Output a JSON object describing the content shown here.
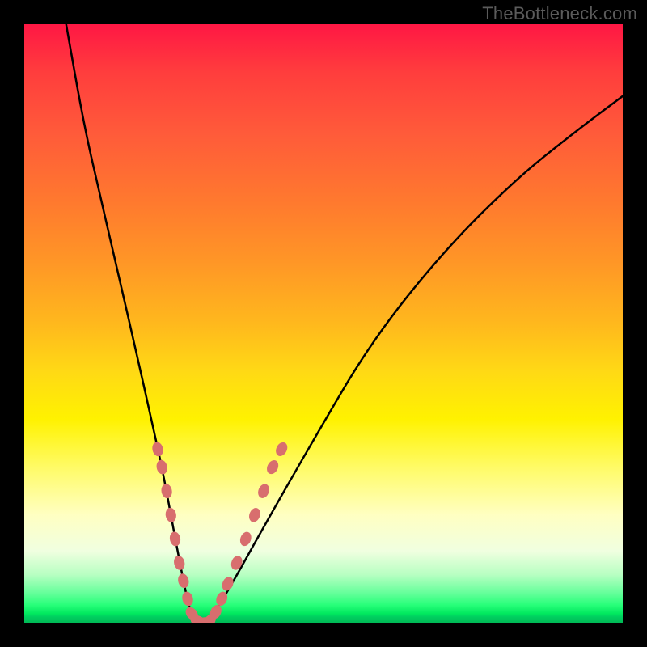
{
  "watermark": "TheBottleneck.com",
  "chart_data": {
    "type": "line",
    "title": "",
    "xlabel": "",
    "ylabel": "",
    "xlim": [
      0,
      100
    ],
    "ylim": [
      0,
      100
    ],
    "grid": false,
    "legend": false,
    "background_gradient_stops": [
      {
        "pct": 0,
        "color": "#ff1744"
      },
      {
        "pct": 8,
        "color": "#ff3d3d"
      },
      {
        "pct": 18,
        "color": "#ff5a3a"
      },
      {
        "pct": 30,
        "color": "#ff7a2e"
      },
      {
        "pct": 40,
        "color": "#ff9726"
      },
      {
        "pct": 50,
        "color": "#ffb81d"
      },
      {
        "pct": 58,
        "color": "#ffd915"
      },
      {
        "pct": 66,
        "color": "#fff200"
      },
      {
        "pct": 74,
        "color": "#fffb66"
      },
      {
        "pct": 82,
        "color": "#ffffc2"
      },
      {
        "pct": 88,
        "color": "#f0ffe0"
      },
      {
        "pct": 92,
        "color": "#b7ffc2"
      },
      {
        "pct": 95,
        "color": "#66ff9b"
      },
      {
        "pct": 97,
        "color": "#29ff7a"
      },
      {
        "pct": 98.5,
        "color": "#00e85e"
      },
      {
        "pct": 99,
        "color": "#00d060"
      },
      {
        "pct": 100,
        "color": "#00b855"
      }
    ],
    "series": [
      {
        "name": "bottleneck-curve",
        "color": "#000000",
        "x": [
          7,
          10,
          13,
          16,
          19,
          21,
          23,
          24.5,
          26,
          27,
          28,
          29,
          30,
          32,
          35,
          40,
          48,
          58,
          70,
          82,
          92,
          100
        ],
        "y": [
          100,
          83,
          70,
          57,
          44,
          35,
          26,
          18,
          10,
          5,
          1,
          0,
          0,
          2,
          7,
          16,
          30,
          47,
          62,
          74,
          82,
          88
        ]
      }
    ],
    "markers": {
      "name": "highlighted-points",
      "color": "#d86e6e",
      "points": [
        {
          "x": 22.3,
          "y": 29
        },
        {
          "x": 23.0,
          "y": 26
        },
        {
          "x": 23.8,
          "y": 22
        },
        {
          "x": 24.5,
          "y": 18
        },
        {
          "x": 25.2,
          "y": 14
        },
        {
          "x": 25.9,
          "y": 10
        },
        {
          "x": 26.6,
          "y": 7
        },
        {
          "x": 27.3,
          "y": 4
        },
        {
          "x": 28.0,
          "y": 1.5
        },
        {
          "x": 29.0,
          "y": 0.3
        },
        {
          "x": 30.0,
          "y": 0
        },
        {
          "x": 31.0,
          "y": 0.3
        },
        {
          "x": 32.0,
          "y": 1.8
        },
        {
          "x": 33.0,
          "y": 4
        },
        {
          "x": 34.0,
          "y": 6.5
        },
        {
          "x": 35.5,
          "y": 10
        },
        {
          "x": 37.0,
          "y": 14
        },
        {
          "x": 38.5,
          "y": 18
        },
        {
          "x": 40.0,
          "y": 22
        },
        {
          "x": 41.5,
          "y": 26
        },
        {
          "x": 43.0,
          "y": 29
        }
      ]
    }
  }
}
